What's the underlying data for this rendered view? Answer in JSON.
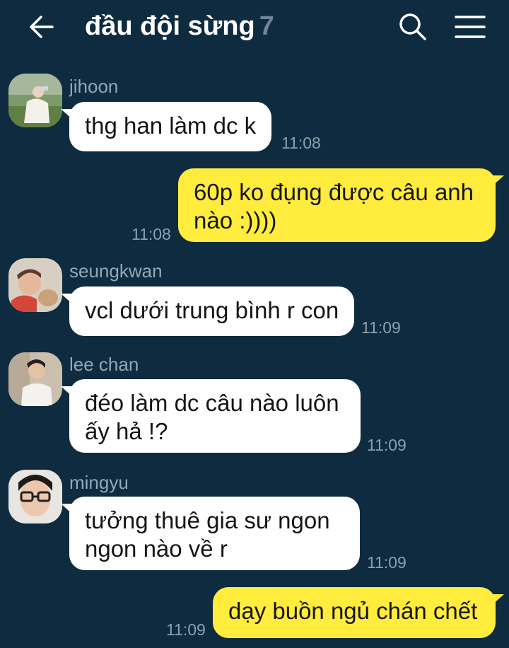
{
  "header": {
    "title": "đầu đội sừng",
    "member_count": "7"
  },
  "messages": [
    {
      "sender": "jihoon",
      "text": "thg han làm dc k",
      "time": "11:08"
    },
    {
      "sender": "",
      "text_lines": [
        "60p ko đụng được câu anh",
        "nào :))))"
      ],
      "time": "11:08"
    },
    {
      "sender": "seungkwan",
      "text": "vcl dưới trung bình r con",
      "time": "11:09"
    },
    {
      "sender": "lee chan",
      "text_lines": [
        "đéo làm dc câu nào luôn",
        "ấy hả !?"
      ],
      "time": "11:09"
    },
    {
      "sender": "mingyu",
      "text_lines": [
        "tưởng thuê gia sư ngon",
        "ngon nào về r"
      ],
      "time": "11:09"
    },
    {
      "sender": "",
      "text": "dạy buồn ngủ chán chết",
      "time": "11:09"
    }
  ],
  "colors": {
    "background": "#0f2b3f",
    "incoming_bubble": "#ffffff",
    "outgoing_bubble": "#ffec3d",
    "meta_text": "#8aa0ae"
  },
  "icons": [
    "back-arrow-icon",
    "search-icon",
    "menu-icon"
  ]
}
